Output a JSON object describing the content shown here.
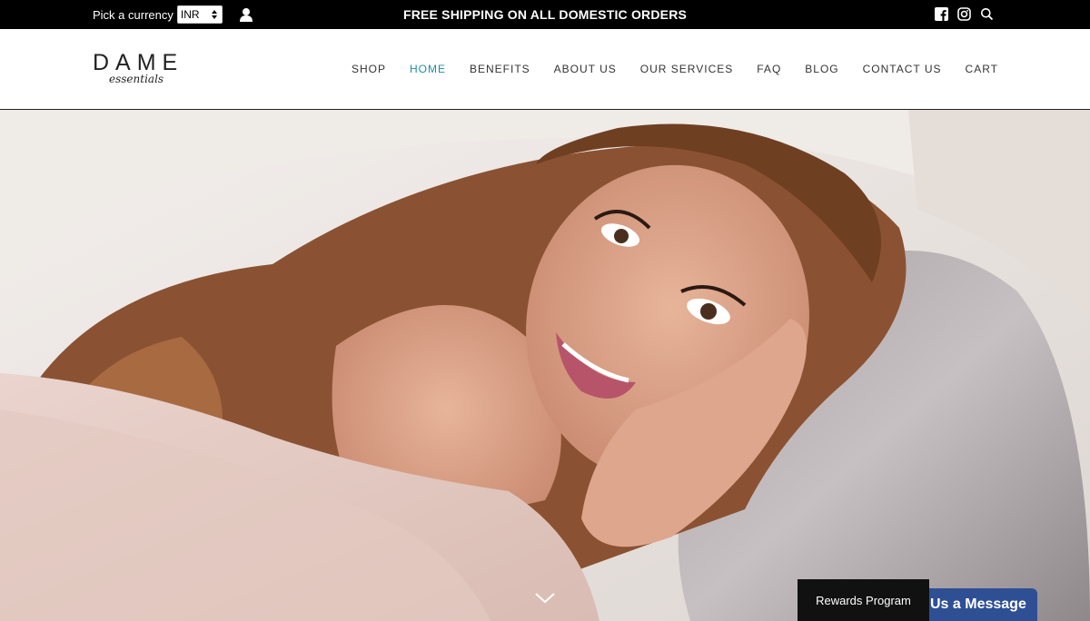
{
  "topbar": {
    "currency_label": "Pick a currency",
    "currency_value": "INR",
    "announcement": "FREE SHIPPING ON ALL DOMESTIC ORDERS"
  },
  "header": {
    "logo_main": "DAME",
    "logo_sub": "essentials",
    "nav": [
      {
        "label": "SHOP"
      },
      {
        "label": "HOME",
        "active": true
      },
      {
        "label": "BENEFITS"
      },
      {
        "label": "ABOUT US"
      },
      {
        "label": "OUR SERVICES"
      },
      {
        "label": "FAQ"
      },
      {
        "label": "BLOG"
      },
      {
        "label": "CONTACT US"
      },
      {
        "label": "CART"
      }
    ]
  },
  "hero": {
    "image_alt": "Smiling woman with wavy auburn hair resting on a grey pillow"
  },
  "widgets": {
    "rewards_label": "Rewards Program",
    "message_label": "Us a Message"
  },
  "icons": [
    "user-icon",
    "facebook-icon",
    "instagram-icon",
    "search-icon",
    "chevron-down-icon"
  ],
  "colors": {
    "topbar_bg": "#000000",
    "nav_active": "#1c8fa6",
    "message_bg": "#2f4f94"
  }
}
